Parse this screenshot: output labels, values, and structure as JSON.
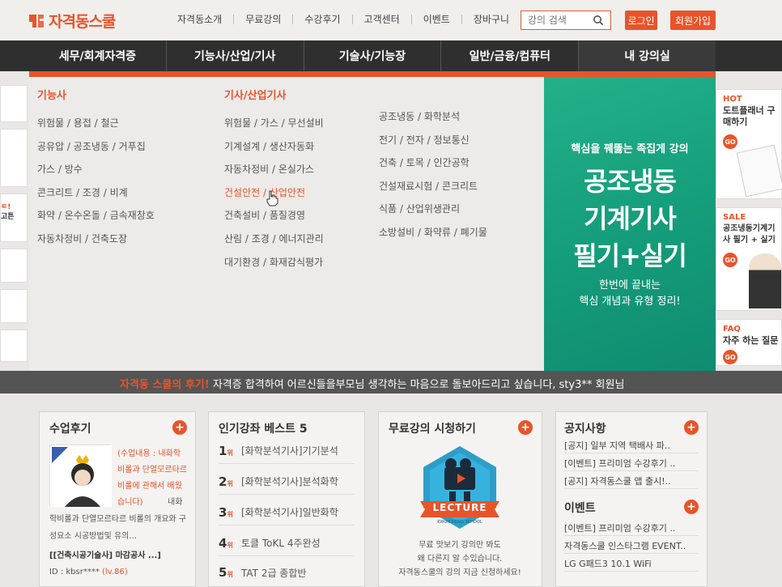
{
  "brand": {
    "name": "자격동스쿨",
    "accent": "#e8542a",
    "green": "#17a47f"
  },
  "topnav": [
    "자격동소개",
    "무료강의",
    "수강후기",
    "고객센터",
    "이벤트",
    "장바구니"
  ],
  "search": {
    "placeholder": "강의 검색"
  },
  "auth": {
    "login": "로그인",
    "join": "회원가입"
  },
  "mainnav": [
    "세무/회계자격증",
    "기능사/산업/기사",
    "기술사/기능장",
    "일반/금융/컴퓨터",
    "내 강의실"
  ],
  "mega": {
    "col1": {
      "head": "기능사",
      "items": [
        "위험물 / 용접 / 철근",
        "공유압 / 공조냉동 / 거푸집",
        "가스 / 방수",
        "콘크리트 / 조경 / 비계",
        "화약 / 온수온돌 / 금속재창호",
        "자동차정비 / 건축도장"
      ]
    },
    "col2": {
      "head": "기사/산업기사",
      "items": [
        "위험물 / 가스 / 무선설비",
        "기계설계 / 생산자동화",
        "자동차정비 / 온실가스",
        "건설안전 / 산업안전",
        "건축설비 / 품질경영",
        "산림 / 조경 / 에너지관리",
        "대기환경 / 화재감식평가"
      ]
    },
    "col3": {
      "items": [
        "공조냉동 / 화학분석",
        "전기 / 전자 / 정보통신",
        "건축 / 토목 / 인간공학",
        "건설재료시험 / 콘크리트",
        "식품 / 산업위생관리",
        "소방설비 / 화약류 / 폐기물"
      ]
    }
  },
  "promo": {
    "sub": "핵심을 꿰뚫는 족집게 강의",
    "title1": "공조냉동",
    "title2": "기계기사",
    "title3": "필기+실기",
    "foot1": "한번에 끝내는",
    "foot2": "핵심 개념과 유형 정리!"
  },
  "side_right": [
    {
      "tag": "HOT",
      "title": "도트플래너 구매하기",
      "go": "GO"
    },
    {
      "tag": "SALE",
      "title": "공조냉동기계기사 필기 + 실기",
      "go": "GO"
    },
    {
      "tag": "FAQ",
      "title": "자주 하는 질문",
      "go": "GO"
    }
  ],
  "side_left_text": [
    "ㅌ!",
    "고튼"
  ],
  "ticker": {
    "highlight": "자격동 스쿨의 후기!",
    "text": "자격증 합격하여 어르신들을부모님 생각하는 마음으로 돌보아드리고 싶습니다, sty3** 회원님"
  },
  "review": {
    "title": "수업후기",
    "quote": "(수업내용 : 내화학 비롤과 단열모르타르비롤에 관해서 배웠습니다)",
    "tail": "내화",
    "cont": "학비롤과 단열모르타르 비롤의 개요와 구성요소 시공방법및 유의...",
    "link": "[[건축시공기술사] 마감공사 ...]",
    "id": "ID : kbsr****",
    "level": "(lv.86)"
  },
  "best": {
    "title": "인기강좌 베스트 5",
    "rank_suffix": "위",
    "items": [
      {
        "rank": "1",
        "name": "[화학분석기사]기기분석"
      },
      {
        "rank": "2",
        "name": "[화학분석기사]분석화학"
      },
      {
        "rank": "3",
        "name": "[화학분석기사]일반화학"
      },
      {
        "rank": "4",
        "name": "토클 ToKL 4주완성"
      },
      {
        "rank": "5",
        "name": "TAT 2급 종합반"
      }
    ]
  },
  "free": {
    "title": "무료강의 시청하기",
    "badge": "LECTURE",
    "badge_sub": "KWON DONG SCHOOL",
    "text1": "무료 맛보기 강의만 봐도",
    "text2": "왜 다른지 알 수있습니다.",
    "text3": "자격동스쿨의 강의 지금 신청하세요!"
  },
  "notice": {
    "title": "공지사항",
    "items": [
      "[공지] 일부 지역 택배사 파..",
      "[이벤트] 프리미엄 수강후기 ..",
      "[공지] 자격동스쿨 앱 출시!.."
    ],
    "event_title": "이벤트",
    "events": [
      "[이벤트] 프리미엄 수강후기 ..",
      "자격동스쿨 인스타그램 EVENT..",
      "LG G패드3 10.1 WiFi"
    ]
  },
  "plus": "+"
}
